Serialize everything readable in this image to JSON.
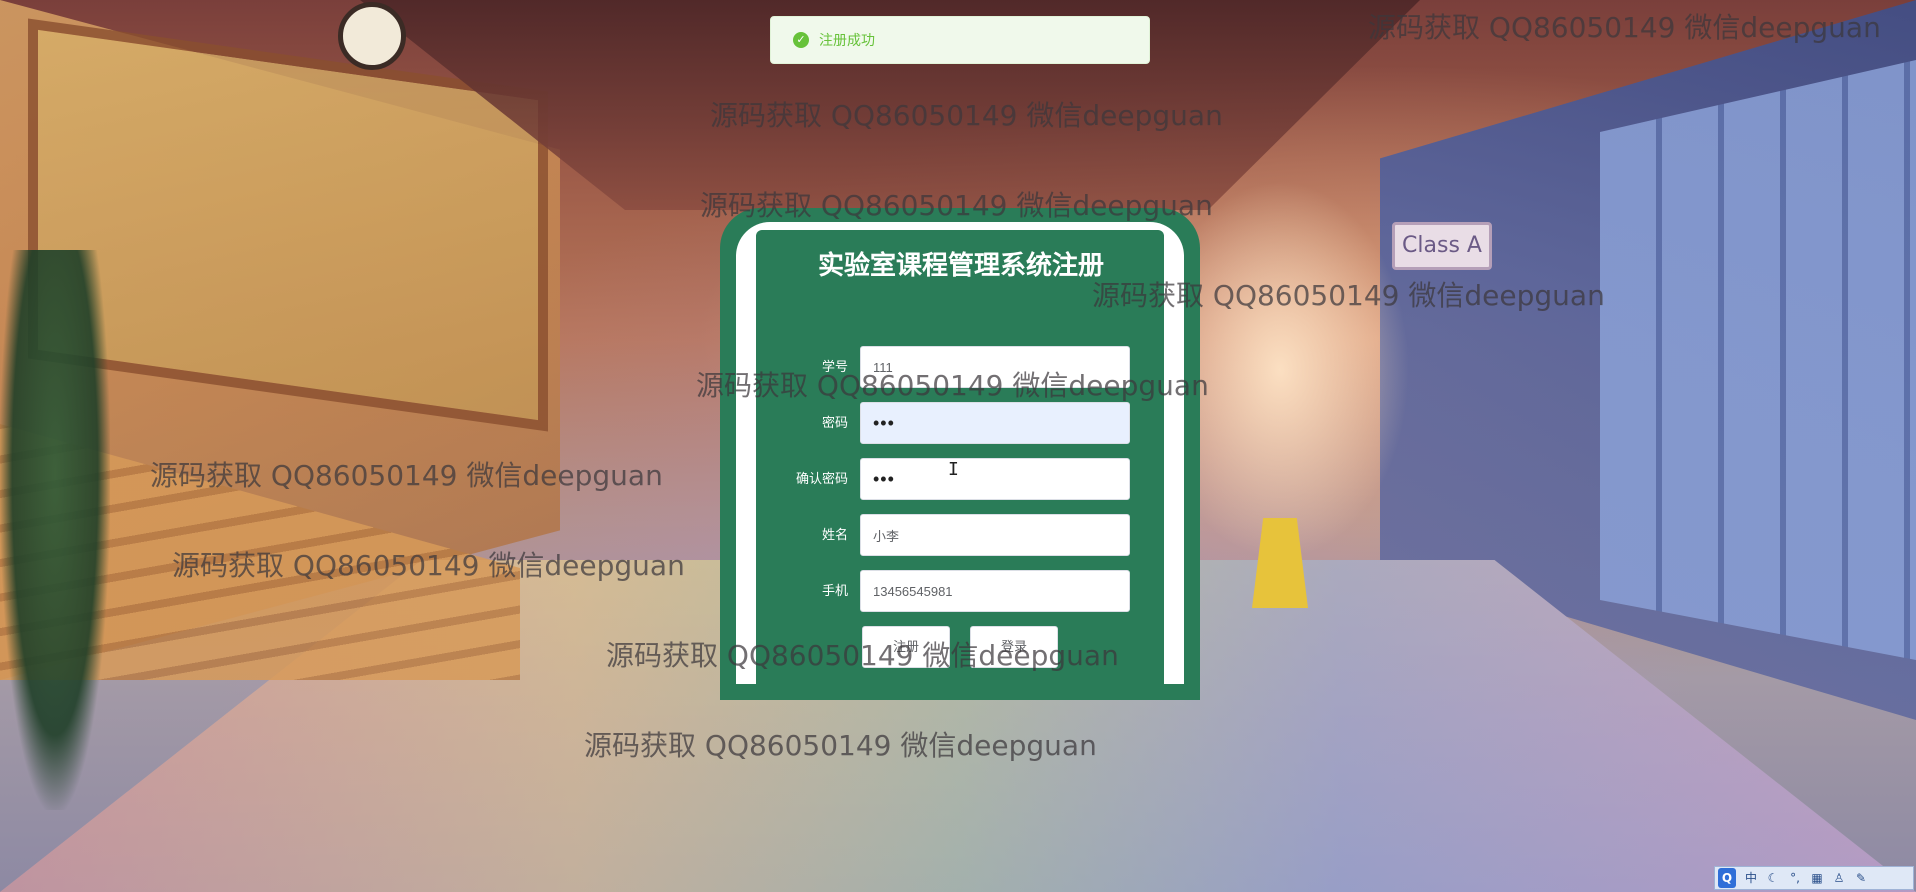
{
  "toast": {
    "message": "注册成功",
    "icon": "check-circle-icon",
    "color": "#67c23a"
  },
  "register": {
    "title": "实验室课程管理系统注册",
    "fields": [
      {
        "label": "学号",
        "value": "111",
        "type": "text"
      },
      {
        "label": "密码",
        "value": "•••",
        "type": "password"
      },
      {
        "label": "确认密码",
        "value": "•••",
        "type": "password"
      },
      {
        "label": "姓名",
        "value": "小李",
        "type": "text"
      },
      {
        "label": "手机",
        "value": "13456545981",
        "type": "text"
      }
    ],
    "buttons": {
      "register": "注册",
      "login": "登录"
    },
    "accent_color": "#2a7c58"
  },
  "background": {
    "class_sign": "Class A"
  },
  "watermark": {
    "text": "源码获取 QQ86050149 微信deepguan"
  },
  "ime": {
    "items": [
      "中",
      "☾",
      "°,",
      "▦",
      "♙",
      "✎"
    ]
  }
}
